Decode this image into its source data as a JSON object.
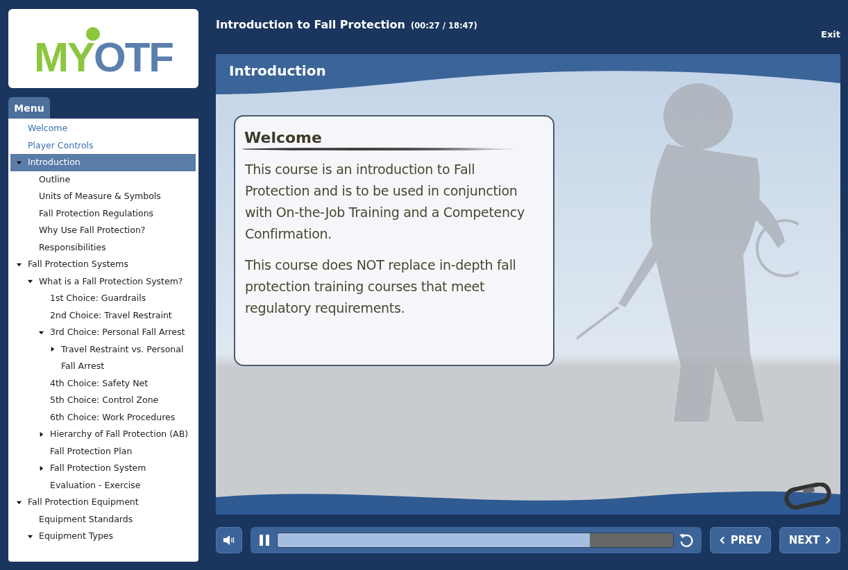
{
  "logo": {
    "lead": "MY",
    "rest": "OTF"
  },
  "course": {
    "title": "Introduction to Fall Protection",
    "time": "(00:27 / 18:47)",
    "exit": "Exit"
  },
  "menu": {
    "tab": "Menu",
    "items": [
      {
        "label": "Welcome",
        "visited": true,
        "selected": false
      },
      {
        "label": "Player Controls",
        "visited": true,
        "selected": false
      },
      {
        "label": "Introduction",
        "visited": false,
        "selected": true,
        "expanded": true,
        "children": [
          {
            "label": "Outline",
            "visited": false,
            "selected": false
          },
          {
            "label": "Units of Measure & Symbols",
            "visited": false,
            "selected": false
          },
          {
            "label": "Fall Protection Regulations",
            "visited": false,
            "selected": false
          },
          {
            "label": "Why Use Fall Protection?",
            "visited": false,
            "selected": false
          },
          {
            "label": "Responsibilities",
            "visited": false,
            "selected": false
          }
        ]
      },
      {
        "label": "Fall Protection Systems",
        "visited": false,
        "selected": false,
        "expanded": true,
        "children": [
          {
            "label": "What is a Fall Protection System?",
            "visited": false,
            "selected": false,
            "expanded": true,
            "children": [
              {
                "label": "1st Choice: Guardrails",
                "visited": false,
                "selected": false
              },
              {
                "label": "2nd Choice: Travel Restraint",
                "visited": false,
                "selected": false
              },
              {
                "label": "3rd Choice: Personal Fall Arrest",
                "visited": false,
                "selected": false,
                "expanded": true,
                "children": [
                  {
                    "label": "Travel Restraint vs. Personal Fall Arrest",
                    "visited": false,
                    "selected": false,
                    "expanded": false
                  }
                ]
              },
              {
                "label": "4th Choice: Safety Net",
                "visited": false,
                "selected": false
              },
              {
                "label": "5th Choice: Control Zone",
                "visited": false,
                "selected": false
              },
              {
                "label": "6th Choice: Work Procedures",
                "visited": false,
                "selected": false
              },
              {
                "label": "Hierarchy of Fall Protection (AB)",
                "visited": false,
                "selected": false,
                "expanded": false
              },
              {
                "label": "Fall Protection Plan",
                "visited": false,
                "selected": false
              },
              {
                "label": "Fall Protection System",
                "visited": false,
                "selected": false,
                "expanded": false
              },
              {
                "label": "Evaluation - Exercise",
                "visited": false,
                "selected": false
              }
            ]
          }
        ]
      },
      {
        "label": "Fall Protection Equipment",
        "visited": false,
        "selected": false,
        "expanded": true,
        "children": [
          {
            "label": "Equipment Standards",
            "visited": false,
            "selected": false
          },
          {
            "label": "Equipment Types",
            "visited": false,
            "selected": false,
            "expanded": true
          }
        ]
      }
    ]
  },
  "slide": {
    "heading": "Introduction",
    "card_title": "Welcome",
    "paragraphs": [
      "This course is an introduction to Fall Protection and is to be used in conjunction with On-the-Job Training and a Competency Confirmation.",
      "This course does NOT replace in-depth fall protection training courses that meet regulatory requirements."
    ]
  },
  "player": {
    "playing": true,
    "level": 0.79,
    "prev": "PREV",
    "next": "NEXT"
  }
}
